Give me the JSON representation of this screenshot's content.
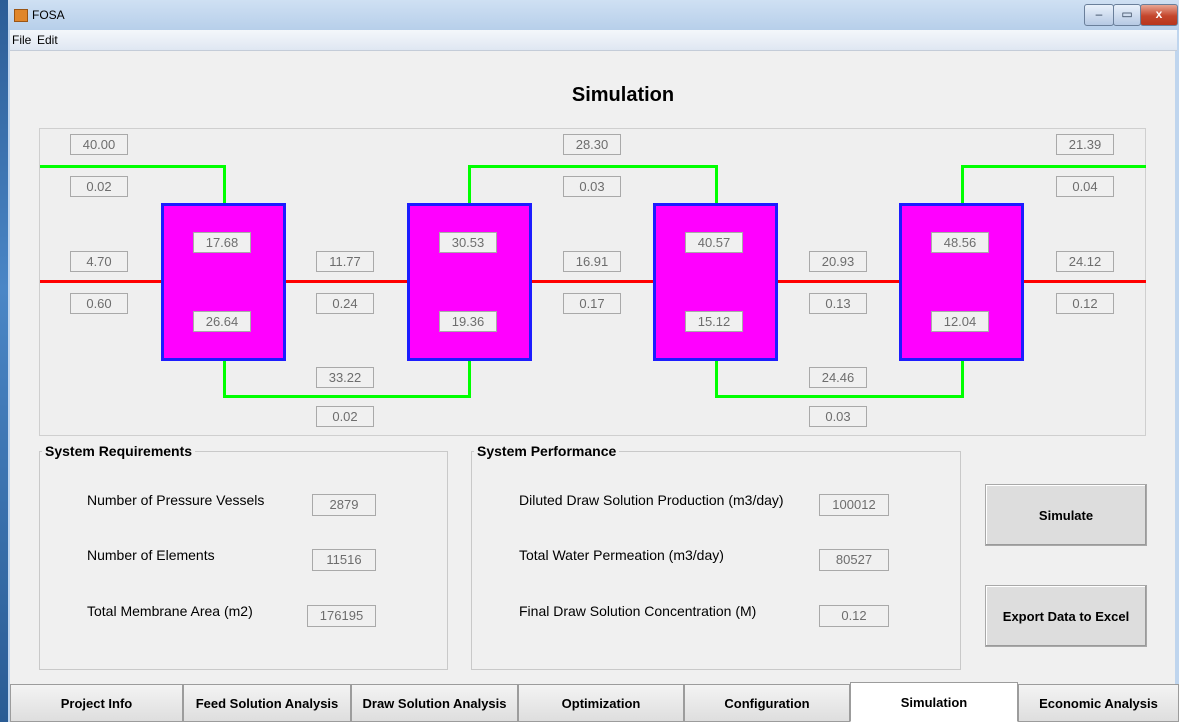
{
  "window": {
    "title": "FOSA",
    "minimize": "‒",
    "maximize": "▭",
    "close": "x"
  },
  "menu": {
    "file": "File",
    "edit": "Edit"
  },
  "page_title": "Simulation",
  "diagram": {
    "draw_in_conc": "40.00",
    "draw_in_flow": "0.02",
    "draw_mid_conc": "28.30",
    "draw_mid_flow": "0.03",
    "draw_out_conc": "21.39",
    "draw_out_flow": "0.04",
    "feed_in_conc": "4.70",
    "feed_in_flow": "0.60",
    "feed_1_2_conc": "11.77",
    "feed_1_2_flow": "0.24",
    "feed_2_3_conc": "16.91",
    "feed_2_3_flow": "0.17",
    "feed_3_4_conc": "20.93",
    "feed_3_4_flow": "0.13",
    "feed_out_conc": "24.12",
    "feed_out_flow": "0.12",
    "draw_low_1_conc": "33.22",
    "draw_low_1_flow": "0.02",
    "draw_low_2_conc": "24.46",
    "draw_low_2_flow": "0.03",
    "vessels": [
      {
        "top": "17.68",
        "bottom": "26.64"
      },
      {
        "top": "30.53",
        "bottom": "19.36"
      },
      {
        "top": "40.57",
        "bottom": "15.12"
      },
      {
        "top": "48.56",
        "bottom": "12.04"
      }
    ]
  },
  "requirements": {
    "title": "System Requirements",
    "rows": [
      {
        "label": "Number of Pressure Vessels",
        "value": "2879"
      },
      {
        "label": "Number of Elements",
        "value": "11516"
      },
      {
        "label": "Total Membrane Area (m2)",
        "value": "176195"
      }
    ]
  },
  "performance": {
    "title": "System Performance",
    "rows": [
      {
        "label": "Diluted Draw Solution Production (m3/day)",
        "value": "100012"
      },
      {
        "label": "Total Water Permeation (m3/day)",
        "value": "80527"
      },
      {
        "label": "Final Draw Solution Concentration (M)",
        "value": "0.12"
      }
    ]
  },
  "buttons": {
    "simulate": "Simulate",
    "export": "Export Data to Excel"
  },
  "tabs": [
    "Project Info",
    "Feed Solution Analysis",
    "Draw Solution Analysis",
    "Optimization",
    "Configuration",
    "Simulation",
    "Economic Analysis"
  ],
  "active_tab": "Simulation",
  "colors": {
    "vessel_fill": "#ff00ff",
    "vessel_border": "#1c1cff",
    "draw_line": "#00ff00",
    "feed_line": "#ff0000"
  }
}
